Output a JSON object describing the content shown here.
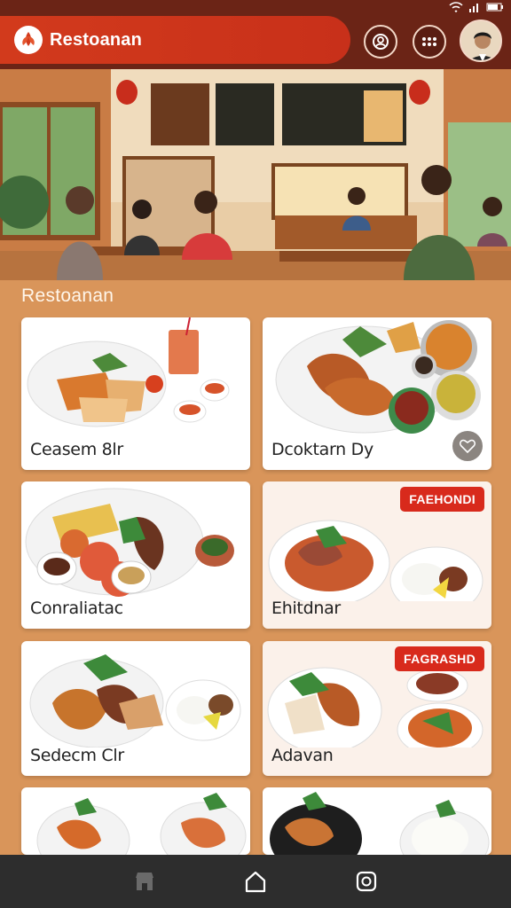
{
  "status": {
    "icons": [
      "wifi-icon",
      "signal-icon",
      "battery-icon"
    ],
    "text": "ᐧ"
  },
  "header": {
    "brand": "Restoanan",
    "logo_icon": "leaf-logo-icon",
    "actions": [
      "user-scan-icon",
      "menu-dots-icon",
      "avatar"
    ]
  },
  "section": {
    "title": "Restoanan"
  },
  "cards": [
    {
      "label": "Ceasem 8lr",
      "badge": "",
      "favorite": false
    },
    {
      "label": "Dcoktarn Dy",
      "badge": "",
      "favorite": true
    },
    {
      "label": "Conraliatac",
      "badge": "",
      "favorite": false
    },
    {
      "label": "Ehitdnar",
      "badge": "FAEHONDI",
      "favorite": false
    },
    {
      "label": "Sedecm Clr",
      "badge": "",
      "favorite": false
    },
    {
      "label": "Adavan",
      "badge": "FAGRASHD",
      "favorite": false
    },
    {
      "label": "",
      "badge": "",
      "favorite": false
    },
    {
      "label": "",
      "badge": "",
      "favorite": false
    }
  ],
  "bottom_nav": [
    "store-icon",
    "home-icon",
    "camera-icon"
  ],
  "colors": {
    "header": "#6b2416",
    "brand_red": "#d23a1c",
    "background": "#d9955a",
    "nav": "#2d2d2d",
    "badge": "#d82a1c"
  }
}
